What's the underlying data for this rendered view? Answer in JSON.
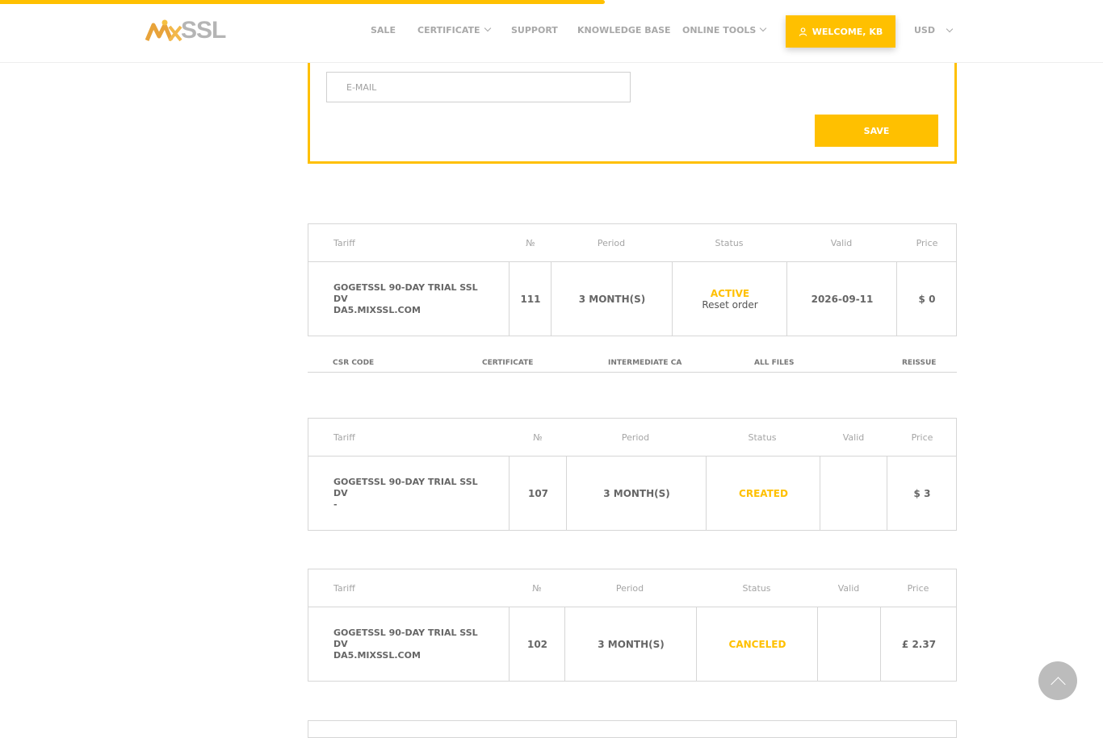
{
  "brand": {
    "logo_text": "SSL",
    "colors": {
      "accent": "#ffc000",
      "text": "#666666"
    }
  },
  "nav": {
    "sale": "SALE",
    "certificate": "CERTIFICATE",
    "support": "SUPPORT",
    "knowledge_base": "KNOWLEDGE BASE",
    "online_tools": "ONLINE TOOLS",
    "welcome": "WELCOME, KB",
    "currency": "USD"
  },
  "form": {
    "email_placeholder": "E-MAIL",
    "save_label": "SAVE"
  },
  "table_headers": {
    "tariff": "Tariff",
    "number": "№",
    "period": "Period",
    "status": "Status",
    "valid": "Valid",
    "price": "Price"
  },
  "orders": [
    {
      "tariff": "GOGETSSL 90-DAY TRIAL SSL DV",
      "domain": "DA5.MIXSSL.COM",
      "number": "111",
      "period": "3 MONTH(S)",
      "status": "ACTIVE",
      "status_action": "Reset order",
      "valid": "2026-09-11",
      "price": "$ 0"
    },
    {
      "tariff": "GOGETSSL 90-DAY TRIAL SSL DV",
      "domain": "-",
      "number": "107",
      "period": "3 MONTH(S)",
      "status": "CREATED",
      "valid": "",
      "price": "$ 3"
    },
    {
      "tariff": "GOGETSSL 90-DAY TRIAL SSL DV",
      "domain": "DA5.MIXSSL.COM",
      "number": "102",
      "period": "3 MONTH(S)",
      "status": "CANCELED",
      "valid": "",
      "price": "£ 2.37"
    }
  ],
  "actions": {
    "csr": "CSR CODE",
    "certificate": "CERTIFICATE",
    "intermediate": "INTERMEDIATE CA",
    "all_files": "ALL FILES",
    "reissue": "REISSUE"
  }
}
